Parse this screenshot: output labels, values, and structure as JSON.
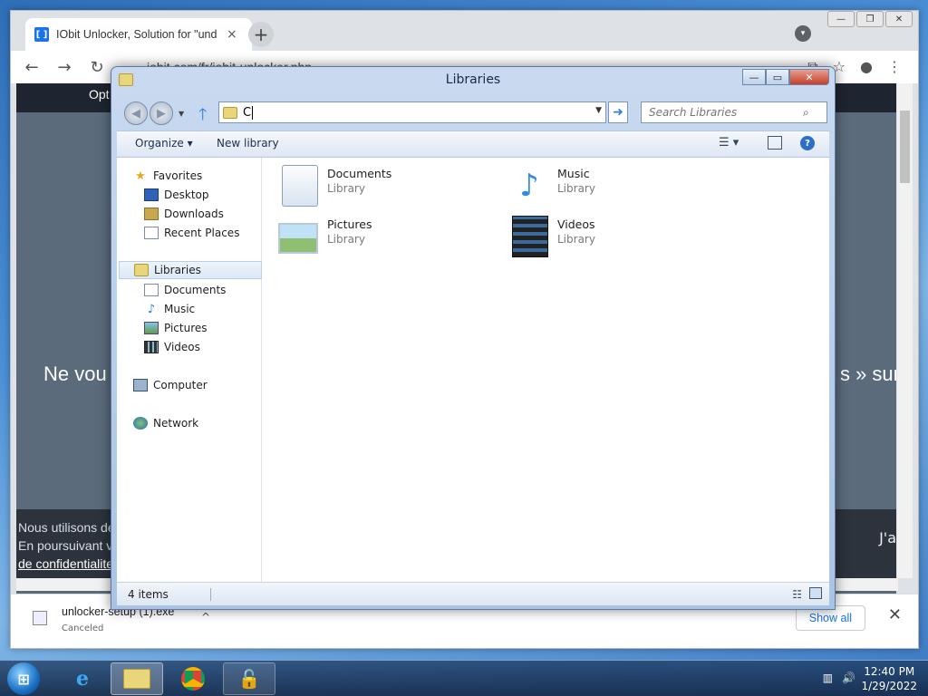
{
  "browser": {
    "tab_title": "IObit Unlocker, Solution for \"und",
    "tab_favicon": "[ ]",
    "tab_close": "×",
    "new_tab": "+",
    "url": "iobit.com/fr/iobit-unlocker.php",
    "win_minimize": "—",
    "win_restore": "❐",
    "win_close": "✕",
    "back": "←",
    "forward": "→",
    "reload": "↻",
    "page": {
      "nav_text": "Opt",
      "hero_left": "Ne vou",
      "hero_right": "s » sur",
      "cookie_line1": "Nous utilisons de",
      "cookie_line2": "En poursuivant v",
      "cookie_line3": "de confidentialite",
      "cookie_accept": "J'a"
    },
    "downloads": {
      "file_name": "unlocker-setup (1).exe",
      "status": "Canceled",
      "chevron": "^",
      "show_all": "Show all",
      "close": "✕"
    }
  },
  "explorer": {
    "title": "Libraries",
    "controls": {
      "minimize": "—",
      "maximize": "▭",
      "close": "✕"
    },
    "address_value": "C",
    "search_placeholder": "Search Libraries",
    "toolbar": {
      "organize": "Organize ▾",
      "new_library": "New library",
      "views": "☰ ▾",
      "help": "?"
    },
    "nav": {
      "favorites": "Favorites",
      "desktop": "Desktop",
      "downloads": "Downloads",
      "recent": "Recent Places",
      "libraries": "Libraries",
      "documents": "Documents",
      "music": "Music",
      "pictures": "Pictures",
      "videos": "Videos",
      "computer": "Computer",
      "network": "Network"
    },
    "libraries": [
      {
        "name": "Documents",
        "type": "Library"
      },
      {
        "name": "Music",
        "type": "Library"
      },
      {
        "name": "Pictures",
        "type": "Library"
      },
      {
        "name": "Videos",
        "type": "Library"
      }
    ],
    "status_count": "4 items"
  },
  "taskbar": {
    "time": "12:40 PM",
    "date": "1/29/2022"
  }
}
